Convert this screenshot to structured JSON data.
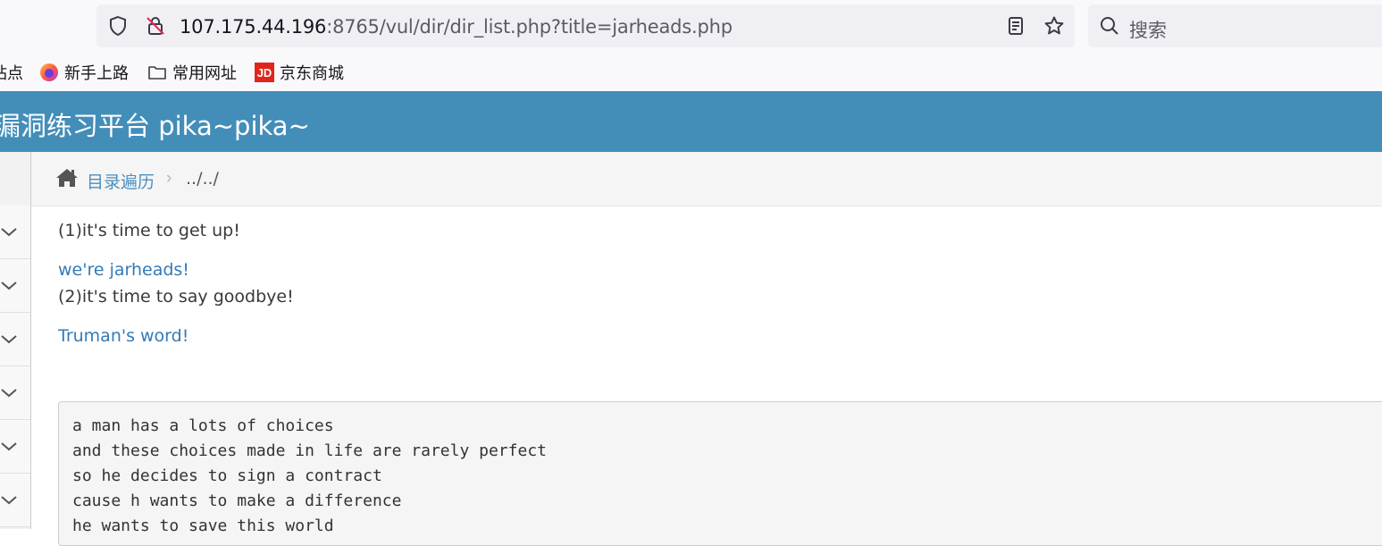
{
  "browser": {
    "url_host": "107.175.44.196",
    "url_rest": ":8765/vul/dir/dir_list.php?title=jarheads.php",
    "search_placeholder": "搜索",
    "icons": [
      "shield-icon",
      "insecure-lock-icon",
      "reader-view-icon",
      "bookmark-star-icon",
      "search-icon"
    ]
  },
  "bookmarks": [
    {
      "label": "站点",
      "icon": ""
    },
    {
      "label": "新手上路",
      "icon": "firefox-icon"
    },
    {
      "label": "常用网址",
      "icon": "folder-icon"
    },
    {
      "label": "京东商城",
      "icon": "jd-icon"
    }
  ],
  "navbar": {
    "brand": "漏洞练习平台 pika~pika~",
    "color": "#438eb9"
  },
  "breadcrumb": {
    "link": "目录遍历",
    "separator": "›",
    "current": "../../"
  },
  "sidebar": {
    "item_count": 6
  },
  "content": {
    "line1": "(1)it's time to get up!",
    "link1": "we're jarheads!",
    "line2": "(2)it's time to say goodbye!",
    "link2": "Truman's word!",
    "poem": [
      "a man has a lots of choices",
      "and these choices made in life are rarely perfect",
      "so he decides to sign a contract",
      "cause h wants to make a difference",
      "he wants to save this world"
    ]
  }
}
